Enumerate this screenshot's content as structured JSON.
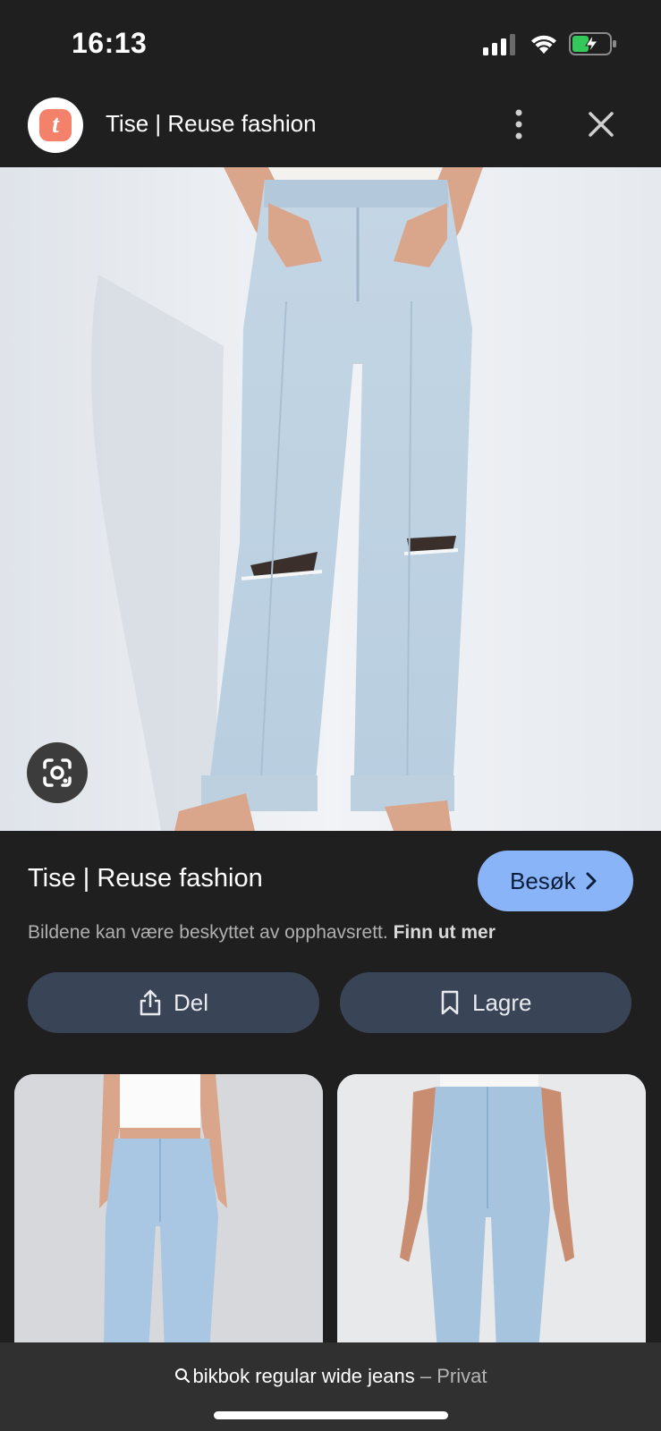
{
  "status_bar": {
    "time": "16:13",
    "battery_charging": true
  },
  "header": {
    "logo_letter": "t",
    "title": "Tise | Reuse fashion"
  },
  "main_image": {
    "description": "light blue ripped straight-leg jeans",
    "lens_icon": "google-lens-icon"
  },
  "info": {
    "source_title": "Tise | Reuse fashion",
    "visit_label": "Besøk",
    "copyright_text": "Bildene kan være beskyttet av opphavsrett.",
    "learn_more_label": "Finn ut mer"
  },
  "actions": {
    "share_label": "Del",
    "save_label": "Lagre"
  },
  "related": [
    {
      "description": "light blue straight jeans with white crop top"
    },
    {
      "description": "light blue slim jeans front view"
    }
  ],
  "bottom_bar": {
    "query": "bikbok regular wide jeans",
    "mode": "– Privat"
  },
  "colors": {
    "background": "#1f1f1f",
    "accent": "#8ab4f8",
    "pill": "#394457"
  }
}
